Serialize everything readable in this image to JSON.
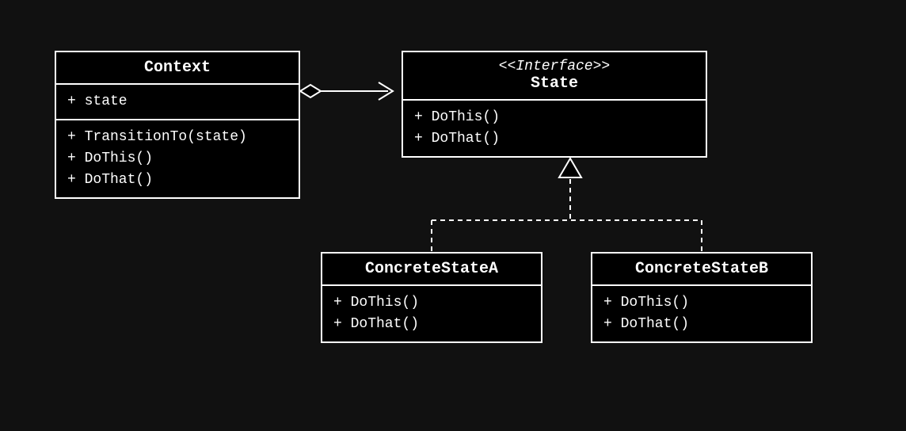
{
  "diagram": {
    "context": {
      "title": "Context",
      "attributes": [
        "+ state"
      ],
      "methods": [
        "+ TransitionTo(state)",
        "+ DoThis()",
        "+ DoThat()"
      ]
    },
    "state": {
      "stereotype": "<<Interface>>",
      "title": "State",
      "methods": [
        "+ DoThis()",
        "+ DoThat()"
      ]
    },
    "concreteA": {
      "title": "ConcreteStateA",
      "methods": [
        "+ DoThis()",
        "+ DoThat()"
      ]
    },
    "concreteB": {
      "title": "ConcreteStateB",
      "methods": [
        "+ DoThis()",
        "+ DoThat()"
      ]
    }
  }
}
